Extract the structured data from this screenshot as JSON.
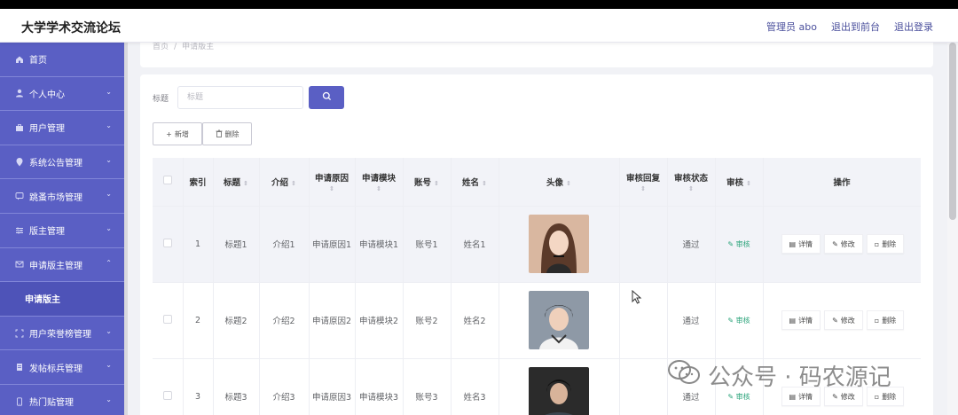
{
  "app": {
    "title": "大学学术交流论坛",
    "header_actions": [
      "管理员 abo",
      "退出到前台",
      "退出登录"
    ]
  },
  "sidebar": {
    "items": [
      {
        "label": "首页",
        "icon": "home-icon",
        "has_children": false
      },
      {
        "label": "个人中心",
        "icon": "user-icon",
        "has_children": true
      },
      {
        "label": "用户管理",
        "icon": "briefcase-icon",
        "has_children": true
      },
      {
        "label": "系统公告管理",
        "icon": "location-icon",
        "has_children": true
      },
      {
        "label": "跳蚤市场管理",
        "icon": "chat-icon",
        "has_children": true
      },
      {
        "label": "版主管理",
        "icon": "sliders-icon",
        "has_children": true
      },
      {
        "label": "申请版主管理",
        "icon": "mail-icon",
        "has_children": true,
        "expanded": true
      },
      {
        "label": "用户荣誉榜管理",
        "icon": "expand-icon",
        "has_children": true
      },
      {
        "label": "发帖标兵管理",
        "icon": "document-icon",
        "has_children": true
      },
      {
        "label": "热门贴管理",
        "icon": "phone-icon",
        "has_children": true
      }
    ],
    "active_sub": "申请版主"
  },
  "breadcrumb": {
    "home": "首页",
    "separator": "/",
    "current": "申请版主"
  },
  "search": {
    "label": "标题",
    "placeholder": "标题",
    "button_icon": "search-icon"
  },
  "toolbar": {
    "add_label": "新增",
    "delete_label": "删除"
  },
  "table": {
    "columns": [
      "索引",
      "标题",
      "介绍",
      "申请原因",
      "申请模块",
      "账号",
      "姓名",
      "头像",
      "审核回复",
      "审核状态",
      "审核",
      "操作"
    ],
    "rows": [
      {
        "index": "1",
        "title": "标题1",
        "intro": "介绍1",
        "reason": "申请原因1",
        "module": "申请模块1",
        "account": "账号1",
        "name": "姓名1",
        "reply": "",
        "status": "通过",
        "review": "审核"
      },
      {
        "index": "2",
        "title": "标题2",
        "intro": "介绍2",
        "reason": "申请原因2",
        "module": "申请模块2",
        "account": "账号2",
        "name": "姓名2",
        "reply": "",
        "status": "通过",
        "review": "审核"
      },
      {
        "index": "3",
        "title": "标题3",
        "intro": "介绍3",
        "reason": "申请原因3",
        "module": "申请模块3",
        "account": "账号3",
        "name": "姓名3",
        "reply": "",
        "status": "通过",
        "review": "审核"
      }
    ],
    "row_actions": [
      "详情",
      "修改",
      "删除"
    ]
  },
  "watermark": "公众号 · 码农源记",
  "colors": {
    "primary": "#5a5fc4",
    "review_green": "#2aa37a",
    "header_link": "#4a4f9c"
  }
}
